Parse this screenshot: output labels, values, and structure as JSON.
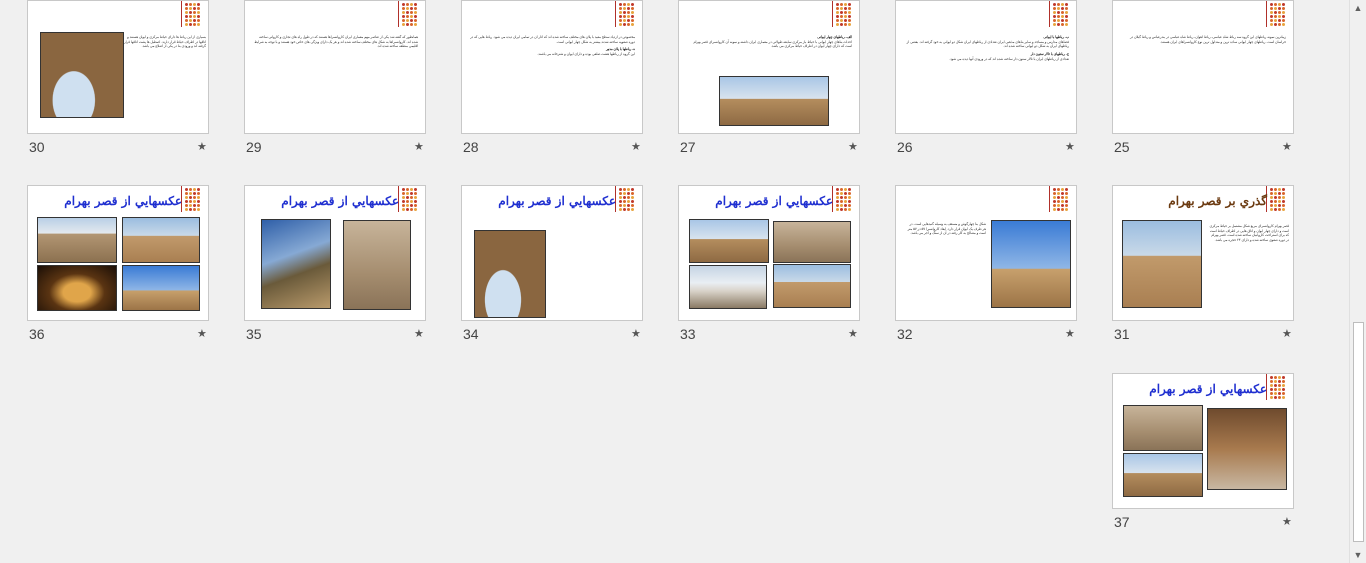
{
  "slides": [
    {
      "number": "25",
      "star": "★",
      "heading": "",
      "text": "زیباترین نمونه رباطهای این گروه سه رباط شاه عباسی، رباط آهوان، رباط شاه عباسی در بندرعباس و رباط گیلان در خراسان است. رباطهای چهار ایوانی ساده ترین و متداول ترین نوع کاروانسراهای ایران هستند."
    },
    {
      "number": "26",
      "star": "★",
      "heading": "ب- رباطها با ایوانی",
      "text": "فضاهای مدارس و مساجد و سایر بناهای مذهبی ایران تعدادی از رباطهای ایران شکل دو ایوانی به خود گرفته اند. بعضی از رباطهای ایران به شکل دو ایوانی ساخته شده اند.",
      "heading2": "ج- رباطهای با تالار ستون دار",
      "text2": "تعدادی از رباطهای ایران با تالار ستون دار ساخته شده اند که در ورودی آنها دیده می شود."
    },
    {
      "number": "27",
      "star": "★",
      "heading": "الف- رباطهای چهار ایوانی",
      "text": "احداث بناهای چهار ایوانی با حیاط باز مرکزی سابقه طولانی در معماری ایران داشته و نمونه آن کاروانسرای قصر بهرام است که دارای چهار ایوان در اطراف حیاط مرکزی می باشد."
    },
    {
      "number": "28",
      "star": "★",
      "heading": "",
      "text": "مخصوص در ازدیاد سطح مفید با پلان های مختلف ساخته شده اند که آثار آن در تمامی ایران دیده می شود. رباط هایی که در دوره صفویه ساخته شدند بیشتر به شکل چهار ایوانی است.",
      "heading2": "ه- رباطها با پلان مدور",
      "text2": "این گروه از رباطها هشت ضلعی بوده و دارای ایوان و شترخانه می باشند."
    },
    {
      "number": "29",
      "star": "★",
      "heading": "",
      "text": "همانطور که گفته شد یکی از عناصر مهم معماری ایران کاروانسراها هستند که در طول راه های تجاری و کاروانی ساخته شده اند. کاروانسراها به شکل های مختلف ساخته شده اند و هر یک دارای ویژگی های خاص خود هستند و با توجه به شرایط اقلیمی منطقه ساخته شده اند."
    },
    {
      "number": "30",
      "star": "★",
      "heading": "",
      "text": "بسیاری از این رباط ها دارای حیاط مرکزی و ایوان هستند و اتاقها در اطراف حیاط قرار دارند. اصطبل ها پشت اتاقها قرار گرفته اند و ورودی بنا در یکی از اضلاع می باشد."
    },
    {
      "number": "31",
      "star": "★",
      "title": "گذري بر قصر بهرام",
      "text": "قصر بهرام کاروانسرای مربع شکل مشتمل بر حیاط مرکزی است و دارای چهار ایوان و اتاق هایی در اطراف حیاط است که برای استراحت کاروانیان ساخته شده است. قصر بهرام در دوره صفوی ساخته شده و دارای ۲۴ حجره می باشد."
    },
    {
      "number": "32",
      "star": "★",
      "text": "شکل بنا چهارگوش و مسقف به وسیله گنبدهایی است. در هر طرف یک ایوان قرار دارد. ابعاد کاروانسرا ۵۷ در ۵۷ متر است و مصالح به کار رفته در آن از سنگ و آجر می باشد."
    },
    {
      "number": "33",
      "star": "★",
      "title": "عکسهايي از قصر بهرام"
    },
    {
      "number": "34",
      "star": "★",
      "title": "عکسهايي از قصر بهرام"
    },
    {
      "number": "35",
      "star": "★",
      "title": "عکسهايي از قصر بهرام"
    },
    {
      "number": "36",
      "star": "★",
      "title": "عکسهايي از قصر بهرام"
    },
    {
      "number": "37",
      "star": "★",
      "title": "عکسهايي از قصر بهرام"
    }
  ],
  "colors": {
    "title_blue": "#1f2fd0",
    "title_brown": "#6b3a10",
    "logo_red": "#c0392b",
    "logo_orange": "#e8a33d"
  },
  "icons": {
    "star": "star-icon",
    "scroll_up": "scroll-up-arrow-icon",
    "scroll_down": "scroll-down-arrow-icon"
  },
  "scrollbar": {
    "up": "▲",
    "down": "▼"
  }
}
